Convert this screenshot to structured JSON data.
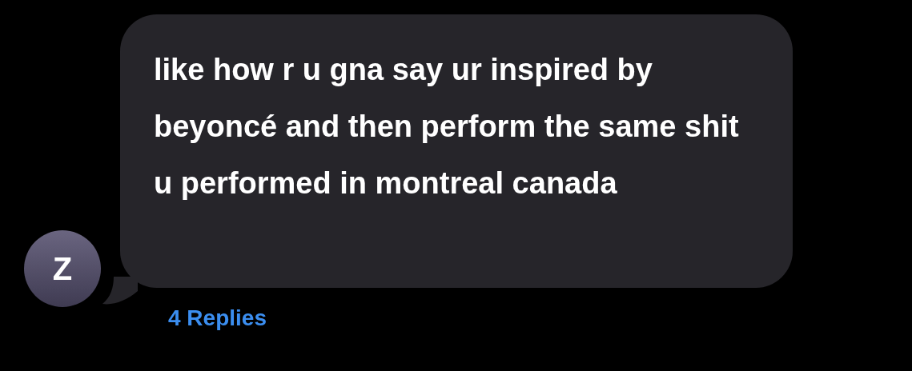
{
  "message": {
    "avatar_initial": "Z",
    "text": "like how r u gna say ur inspired by beyoncé and then perform the same shit u performed in montreal canada",
    "replies": "4 Replies"
  }
}
